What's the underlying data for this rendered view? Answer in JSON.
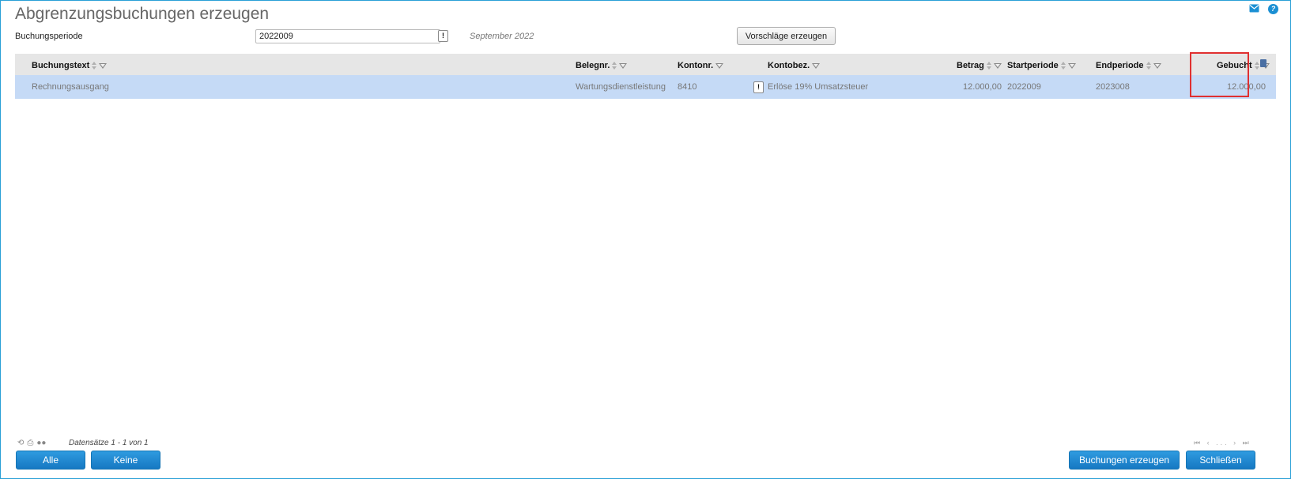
{
  "title": "Abgrenzungsbuchungen erzeugen",
  "top_icons": [
    "mail-icon",
    "help-icon"
  ],
  "help_glyph": "?",
  "period": {
    "label": "Buchungsperiode",
    "value": "2022009",
    "month_text": "September 2022",
    "excl_glyph": "!"
  },
  "generate_button": "Vorschläge erzeugen",
  "columns": {
    "buchungstext": "Buchungstext",
    "belegnr": "Belegnr.",
    "kontonr": "Kontonr.",
    "kontobez": "Kontobez.",
    "betrag": "Betrag",
    "startperiode": "Startperiode",
    "endperiode": "Endperiode",
    "gebucht": "Gebucht"
  },
  "rows": [
    {
      "buchungstext": "Rechnungsausgang",
      "belegnr": "Wartungsdienstleistung",
      "kontonr": "8410",
      "excl_glyph": "!",
      "kontobez": "Erlöse 19% Umsatzsteuer",
      "betrag": "12.000,00",
      "startperiode": "2022009",
      "endperiode": "2023008",
      "gebucht": "12.000,00"
    }
  ],
  "footer": {
    "records_text": "Datensätze 1 - 1 von 1",
    "pager_glyphs": "⏮ ‹ ... › ⏭"
  },
  "buttons": {
    "alle": "Alle",
    "keine": "Keine",
    "buchungen_erzeugen": "Buchungen erzeugen",
    "schliessen": "Schließen"
  },
  "colors": {
    "accent": "#1b8fd3",
    "header_bg": "#e6e6e6",
    "selected_row": "#c5daf6",
    "highlight": "#e03030"
  }
}
